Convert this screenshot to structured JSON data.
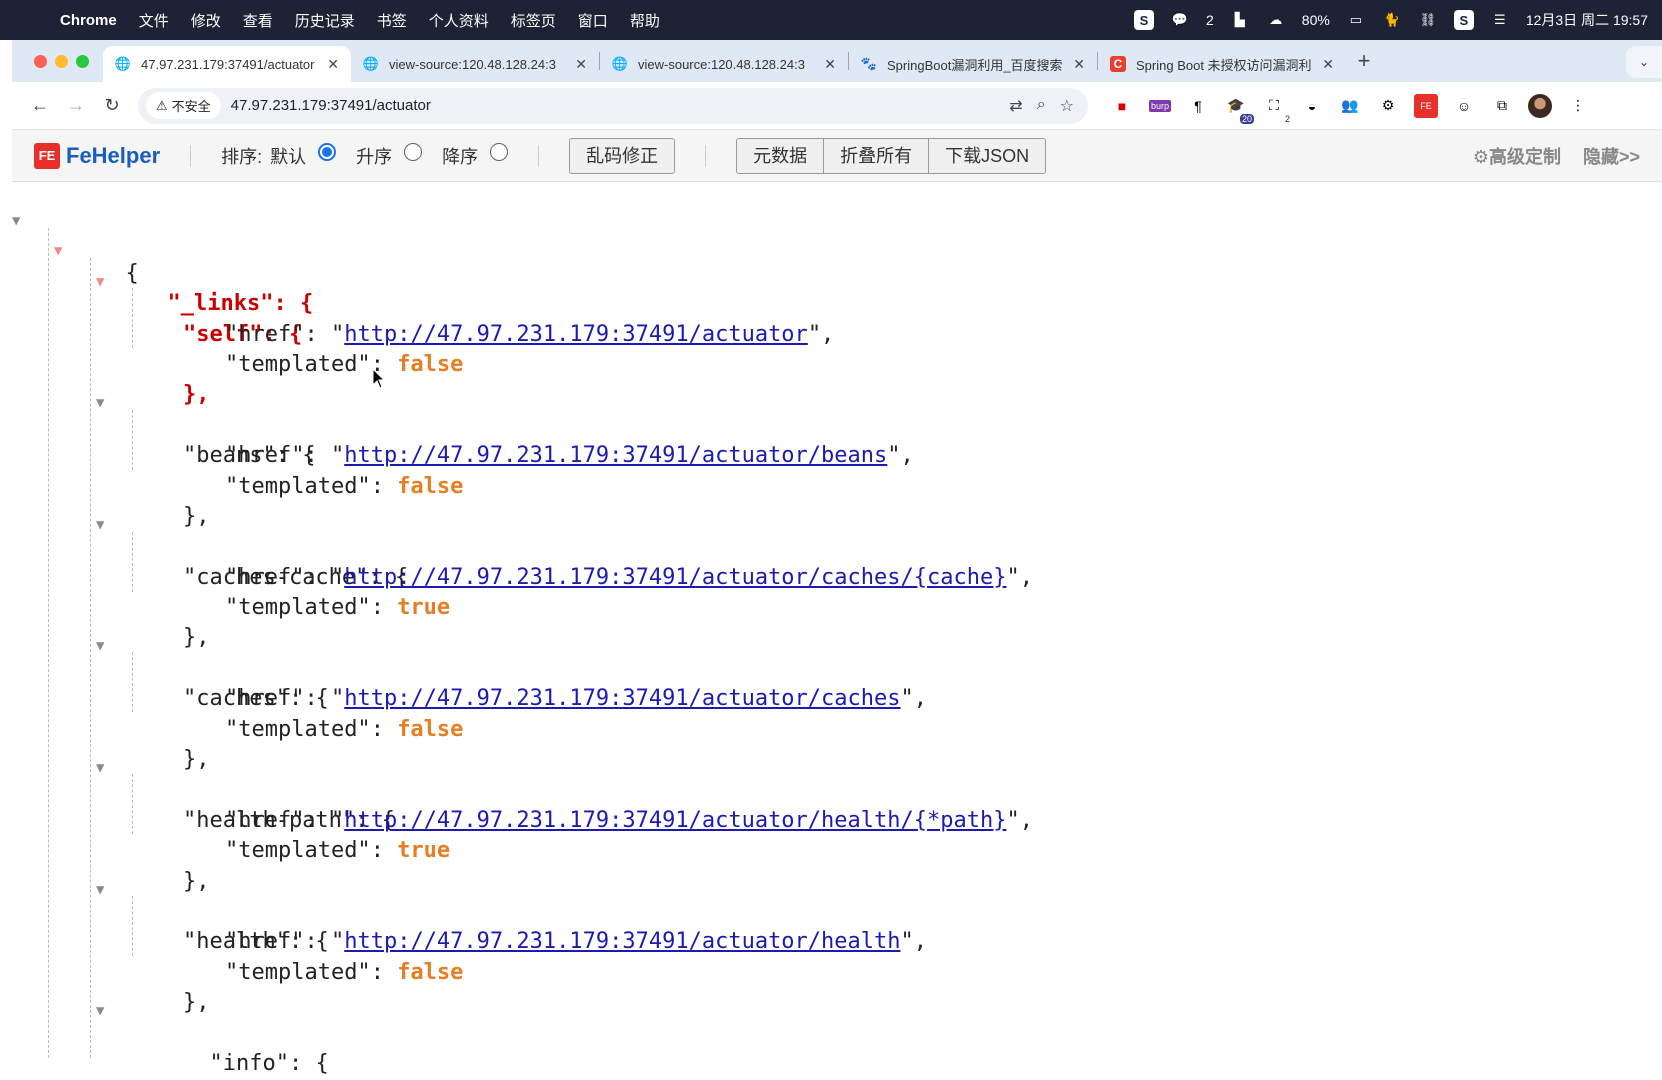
{
  "menubar": {
    "app": "Chrome",
    "items": [
      "文件",
      "修改",
      "查看",
      "历史记录",
      "书签",
      "个人资料",
      "标签页",
      "窗口",
      "帮助"
    ],
    "tray": {
      "wechat_count": "2",
      "battery": "80%",
      "datetime": "12月3日 周二  19:57"
    }
  },
  "tabs": [
    {
      "title": "47.97.231.179:37491/actuator",
      "active": true
    },
    {
      "title": "view-source:120.48.128.24:3"
    },
    {
      "title": "view-source:120.48.128.24:3"
    },
    {
      "title": "SpringBoot漏洞利用_百度搜索"
    },
    {
      "title": "Spring Boot 未授权访问漏洞利"
    }
  ],
  "omnibox": {
    "security": "不安全",
    "url": "47.97.231.179:37491/actuator"
  },
  "extensions": {
    "burp_label": "burp",
    "badge_20": "20",
    "badge_2": "2"
  },
  "fehelper": {
    "brand": "FeHelper",
    "sort_label": "排序:",
    "sort_default": "默认",
    "sort_asc": "升序",
    "sort_desc": "降序",
    "fix_encoding": "乱码修正",
    "metadata": "元数据",
    "collapse_all": "折叠所有",
    "download_json": "下载JSON",
    "advanced": "高级定制",
    "hide": "隐藏>>"
  },
  "json": {
    "links_key": "\"_links\"",
    "entries": [
      {
        "key": "\"self\"",
        "href": "http://47.97.231.179:37491/actuator",
        "templated": "false"
      },
      {
        "key": "\"beans\"",
        "href": "http://47.97.231.179:37491/actuator/beans",
        "templated": "false"
      },
      {
        "key": "\"caches-cache\"",
        "href": "http://47.97.231.179:37491/actuator/caches/{cache}",
        "templated": "true"
      },
      {
        "key": "\"caches\"",
        "href": "http://47.97.231.179:37491/actuator/caches",
        "templated": "false"
      },
      {
        "key": "\"health-path\"",
        "href": "http://47.97.231.179:37491/actuator/health/{*path}",
        "templated": "true"
      },
      {
        "key": "\"health\"",
        "href": "http://47.97.231.179:37491/actuator/health",
        "templated": "false"
      }
    ],
    "next_key": "\"info\""
  }
}
